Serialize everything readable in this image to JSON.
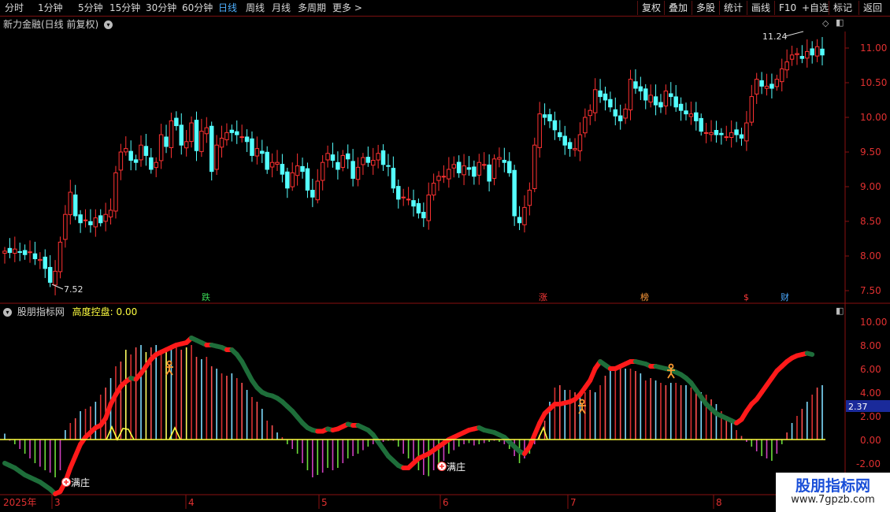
{
  "toolbar": {
    "periods": [
      "分时",
      "1分钟",
      "5分钟",
      "15分钟",
      "30分钟",
      "60分钟",
      "日线",
      "周线",
      "月线",
      "多周期",
      "更多 >"
    ],
    "active_period": "日线",
    "actions": [
      "复权",
      "叠加",
      "多股",
      "统计",
      "画线",
      "F10",
      "+自选",
      "返回",
      "标记"
    ]
  },
  "main_panel": {
    "title": "新力金融(日线 前复权)",
    "high_label": "11.24",
    "low_label": "7.52",
    "price_axis": [
      "11.00",
      "10.50",
      "10.00",
      "9.50",
      "9.00",
      "8.50",
      "8.00",
      "7.50"
    ],
    "event_markers": [
      {
        "text": "跌",
        "color": "#39d353"
      },
      {
        "text": "涨",
        "color": "#ff3a3a"
      },
      {
        "text": "榜",
        "color": "#ff9a3a"
      },
      {
        "text": "$",
        "color": "#ff3a3a"
      },
      {
        "text": "财",
        "color": "#4aa8ff"
      }
    ]
  },
  "indicator_panel": {
    "name": "股朋指标网",
    "label": "高度控盘:",
    "value": "0.00",
    "axis": [
      "10.00",
      "8.00",
      "6.00",
      "4.00",
      "2.00",
      "0.00",
      "-2.00"
    ],
    "current_value_tag": "2.37",
    "signal_labels": [
      "满庄",
      "满庄"
    ]
  },
  "time_axis": [
    "2025年",
    "3",
    "4",
    "5",
    "6",
    "7",
    "8"
  ],
  "watermark": {
    "title": "股朋指标网",
    "url": "www.7gpzb.com"
  },
  "chart_data": {
    "type": "candlestick",
    "title": "新力金融(日线 前复权)",
    "price_range": [
      7.4,
      11.4
    ],
    "high": 11.24,
    "low": 7.52,
    "closes": [
      8.07,
      8.05,
      8.1,
      8.06,
      8.02,
      8.06,
      7.96,
      7.95,
      7.82,
      7.62,
      7.78,
      8.2,
      8.6,
      8.92,
      8.58,
      8.48,
      8.52,
      8.45,
      8.55,
      8.48,
      8.6,
      8.66,
      9.2,
      9.5,
      9.55,
      9.38,
      9.35,
      9.6,
      9.45,
      9.25,
      9.35,
      9.75,
      9.58,
      9.95,
      9.88,
      9.6,
      9.65,
      9.92,
      9.52,
      9.8,
      9.85,
      9.22,
      9.6,
      9.7,
      9.78,
      9.78,
      9.75,
      9.72,
      9.65,
      9.45,
      9.55,
      9.48,
      9.25,
      9.35,
      9.35,
      9.18,
      8.98,
      9.2,
      9.3,
      9.22,
      8.95,
      8.85,
      9.08,
      9.35,
      9.48,
      9.38,
      9.25,
      9.45,
      9.4,
      9.12,
      9.28,
      9.42,
      9.35,
      9.38,
      9.48,
      9.32,
      9.3,
      8.98,
      8.82,
      8.85,
      8.82,
      8.72,
      8.62,
      8.55,
      8.88,
      9.05,
      9.15,
      9.15,
      9.25,
      9.32,
      9.2,
      9.3,
      9.25,
      9.15,
      9.35,
      9.32,
      9.08,
      9.4,
      9.42,
      9.35,
      9.2,
      8.58,
      8.48,
      8.7,
      8.95,
      9.6,
      10.05,
      10.0,
      9.95,
      9.82,
      9.72,
      9.6,
      9.55,
      9.55,
      9.75,
      10.0,
      10.1,
      10.4,
      10.3,
      10.25,
      10.15,
      10.02,
      9.95,
      10.12,
      10.55,
      10.42,
      10.38,
      10.25,
      10.32,
      10.18,
      10.15,
      10.38,
      10.3,
      10.15,
      10.1,
      10.05,
      10.05,
      9.95,
      9.8,
      9.78,
      9.78,
      9.75,
      9.75,
      9.72,
      9.78,
      9.75,
      9.7,
      9.92,
      10.3,
      10.55,
      10.45,
      10.45,
      10.42,
      10.55,
      10.7,
      10.8,
      10.9,
      10.92,
      10.85,
      10.95,
      10.9,
      11.02,
      10.9
    ],
    "indicator": {
      "name": "高度控盘",
      "range": [
        -3.0,
        10.0
      ],
      "histogram": [
        0.5,
        -0.1,
        -0.4,
        -0.8,
        -1.2,
        -1.6,
        -2.0,
        -2.3,
        -2.6,
        -2.8,
        -3.2,
        -2.6,
        0.8,
        1.4,
        1.8,
        2.4,
        2.6,
        2.8,
        3.2,
        3.8,
        4.4,
        5.2,
        6.2,
        6.6,
        7.6,
        7.2,
        7.8,
        8.0,
        7.4,
        7.8,
        8.0,
        7.2,
        7.8,
        7.9,
        7.9,
        7.6,
        7.8,
        8.0,
        7.0,
        6.8,
        7.0,
        6.2,
        6.0,
        5.6,
        5.4,
        5.6,
        5.2,
        4.8,
        4.2,
        3.6,
        3.2,
        2.6,
        1.6,
        1.2,
        0.6,
        0.2,
        -0.4,
        -0.8,
        -1.2,
        -2.0,
        -2.6,
        -3.2,
        -3.0,
        -2.8,
        -2.4,
        -2.6,
        -2.4,
        -2.0,
        -1.6,
        -1.4,
        -1.2,
        -0.9,
        -0.6,
        -0.4,
        -0.3,
        -0.2,
        -0.1,
        -0.1,
        -0.6,
        -1.2,
        -1.6,
        -2.0,
        -2.6,
        -3.0,
        -3.1,
        -2.6,
        -2.2,
        -1.8,
        -1.2,
        -0.9,
        -0.6,
        -0.4,
        -0.3,
        -0.5,
        -0.4,
        -0.3,
        -0.2,
        -0.1,
        -0.2,
        -0.4,
        -0.8,
        -1.4,
        -2.0,
        -1.6,
        -1.2,
        -0.4,
        0.4,
        1.6,
        3.2,
        4.4,
        4.6,
        4.2,
        4.2,
        4.0,
        4.0,
        4.0,
        4.2,
        4.0,
        4.6,
        5.4,
        5.8,
        6.2,
        6.2,
        6.0,
        6.0,
        5.8,
        5.6,
        5.0,
        5.2,
        5.0,
        4.8,
        4.6,
        4.8,
        4.8,
        4.6,
        4.6,
        4.4,
        4.2,
        4.0,
        3.8,
        3.4,
        3.0,
        2.4,
        2.0,
        1.4,
        0.8,
        0.3,
        -0.2,
        -0.6,
        -1.0,
        -1.4,
        -1.6,
        -1.8,
        -1.2,
        -0.4,
        0.6,
        1.4,
        2.0,
        2.6,
        3.2,
        3.8,
        4.4,
        4.6,
        4.8,
        4.8,
        4.8,
        4.6
      ],
      "line": [
        -2.0,
        -2.2,
        -2.4,
        -2.7,
        -3.0,
        -3.2,
        -3.4,
        -3.6,
        -3.9,
        -4.2,
        -4.6,
        -4.4,
        -3.6,
        -2.4,
        -1.4,
        -0.4,
        0.2,
        0.6,
        1.0,
        1.2,
        1.8,
        3.0,
        3.8,
        4.5,
        4.9,
        5.2,
        5.1,
        5.6,
        6.2,
        6.8,
        7.2,
        7.4,
        7.6,
        7.8,
        8.0,
        8.1,
        8.2,
        8.6,
        8.4,
        8.2,
        8.0,
        8.0,
        7.9,
        7.8,
        7.6,
        7.6,
        7.2,
        6.6,
        5.8,
        5.0,
        4.4,
        4.0,
        3.8,
        3.7,
        3.5,
        3.2,
        2.8,
        2.4,
        1.9,
        1.4,
        1.0,
        0.8,
        0.7,
        0.7,
        0.9,
        0.8,
        0.9,
        1.1,
        1.3,
        1.2,
        1.2,
        1.0,
        0.8,
        0.4,
        -0.2,
        -0.8,
        -1.4,
        -1.8,
        -2.2,
        -2.4,
        -2.4,
        -2.0,
        -1.6,
        -1.4,
        -1.2,
        -0.9,
        -0.6,
        -0.3,
        0.0,
        0.2,
        0.4,
        0.6,
        0.8,
        0.9,
        1.0,
        0.8,
        0.7,
        0.6,
        0.4,
        0.2,
        -0.2,
        -0.6,
        -1.0,
        -1.2,
        -0.6,
        0.4,
        1.4,
        2.2,
        2.6,
        3.0,
        3.0,
        3.1,
        3.2,
        3.4,
        3.8,
        4.4,
        5.0,
        6.0,
        6.6,
        6.3,
        6.0,
        6.0,
        6.2,
        6.4,
        6.6,
        6.6,
        6.5,
        6.4,
        6.2,
        6.2,
        6.1,
        6.0,
        5.9,
        5.7,
        5.5,
        5.2,
        4.8,
        4.2,
        3.6,
        3.0,
        2.6,
        2.2,
        2.0,
        1.8,
        1.6,
        1.4,
        1.7,
        2.4,
        3.0,
        3.4,
        4.0,
        4.6,
        5.2,
        5.8,
        6.2,
        6.6,
        6.9,
        7.1,
        7.2,
        7.3,
        7.2
      ]
    }
  }
}
